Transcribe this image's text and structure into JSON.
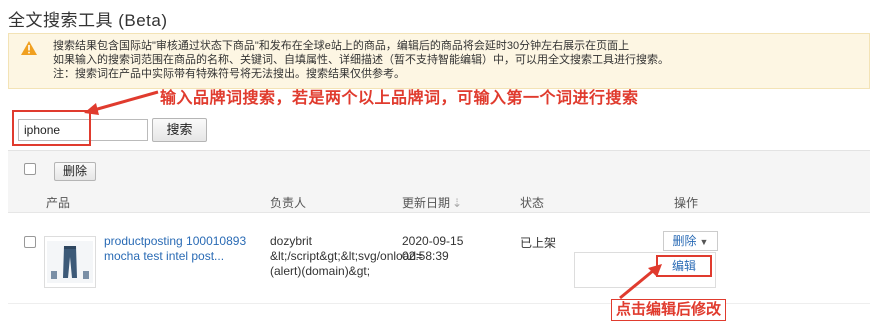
{
  "page": {
    "title": "全文搜索工具  (Beta)"
  },
  "notice": {
    "lines": [
      "搜索结果包含国际站\"审核通过状态下商品\"和发布在全球e站上的商品，编辑后的商品将会延时30分钟左右展示在页面上",
      "如果输入的搜索词范围在商品的名称、关键词、自填属性、详细描述（暂不支持智能编辑）中，可以用全文搜索工具进行搜索。",
      "注：搜索词在产品中实际带有特殊符号将无法搜出。搜索结果仅供参考。"
    ]
  },
  "search": {
    "value": "iphone",
    "button_label": "搜索"
  },
  "annotations": {
    "search_hint": "输入品牌词搜索，若是两个以上品牌词，可输入第一个词进行搜索",
    "edit_hint": "点击编辑后修改"
  },
  "bulk": {
    "delete_label": "删除"
  },
  "table": {
    "headers": {
      "product": "产品",
      "owner": "负责人",
      "updated": "更新日期",
      "status": "状态",
      "actions": "操作"
    },
    "rows": [
      {
        "product_line1": "productposting 100010893",
        "product_line2": "mocha test intel post...",
        "owner_line1": "dozybrit",
        "owner_line2": "&lt;/script&gt;&lt;svg/onload=",
        "owner_line3": "(alert)(domain)&gt;",
        "date_line1": "2020-09-15",
        "date_line2": "02:58:39",
        "status": "已上架",
        "delete_label": "删除",
        "edit_label": "编辑"
      }
    ]
  },
  "colors": {
    "annotation": "#e03b2e",
    "link": "#2a6bb5",
    "notice_bg": "#fdf6e3",
    "warn_icon": "#f0a020"
  }
}
